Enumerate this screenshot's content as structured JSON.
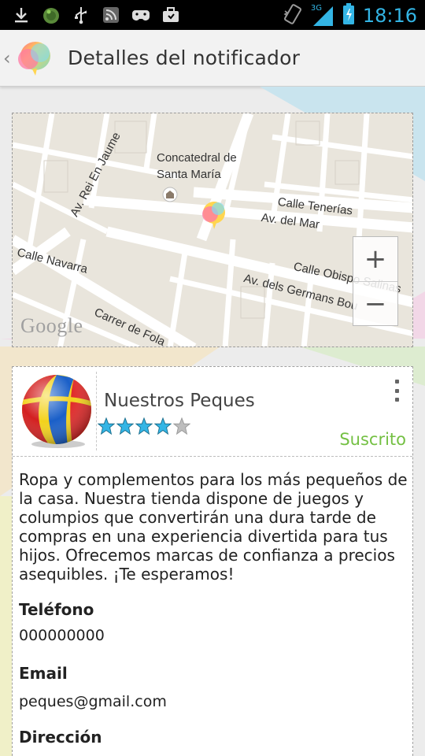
{
  "status_bar": {
    "time": "18:16",
    "network_type": "3G",
    "left_icons": [
      "download-icon",
      "android-icon",
      "usb-icon",
      "rss-icon",
      "gamepad-icon",
      "briefcase-icon"
    ],
    "right_icons": [
      "no-vibrate-icon",
      "signal-icon",
      "battery-charging-icon"
    ]
  },
  "action_bar": {
    "title": "Detalles del notificador",
    "up_icon": "chevron-left-icon",
    "app_icon": "balloon-logo-icon"
  },
  "map": {
    "labels": {
      "cathedral_1": "Concatedral de",
      "cathedral_2": "Santa María",
      "calle_tenerias": "Calle Tenerías",
      "av_del_mar": "Av. del Mar",
      "av_rei_en_jaume": "Av. Rei En Jaume",
      "calle_navarra": "Calle Navarra",
      "calle_obispo_salinas": "Calle Obispo Salinas",
      "av_germans": "Av. dels Germans Bou",
      "carrer_de_fola": "Carrer de Fola",
      "google": "Google"
    },
    "zoom_in": "+",
    "zoom_out": "−"
  },
  "notifier": {
    "name": "Nuestros Peques",
    "rating": 4,
    "rating_max": 5,
    "status": "Suscrito",
    "status_color": "#74c043",
    "description": "Ropa y complementos para los más pequeños de la casa. Nuestra tienda dispone de juegos y columpios que convertirán una dura tarde de compras en una experiencia divertida para tus hijos. Ofrecemos marcas de confianza a precios asequibles. ¡Te esperamos!",
    "phone_label": "Teléfono",
    "phone": "000000000",
    "email_label": "Email",
    "email": "peques@gmail.com",
    "address_label": "Dirección"
  },
  "colors": {
    "accent_clock": "#33b5e5",
    "star_filled": "#33b5e5"
  }
}
